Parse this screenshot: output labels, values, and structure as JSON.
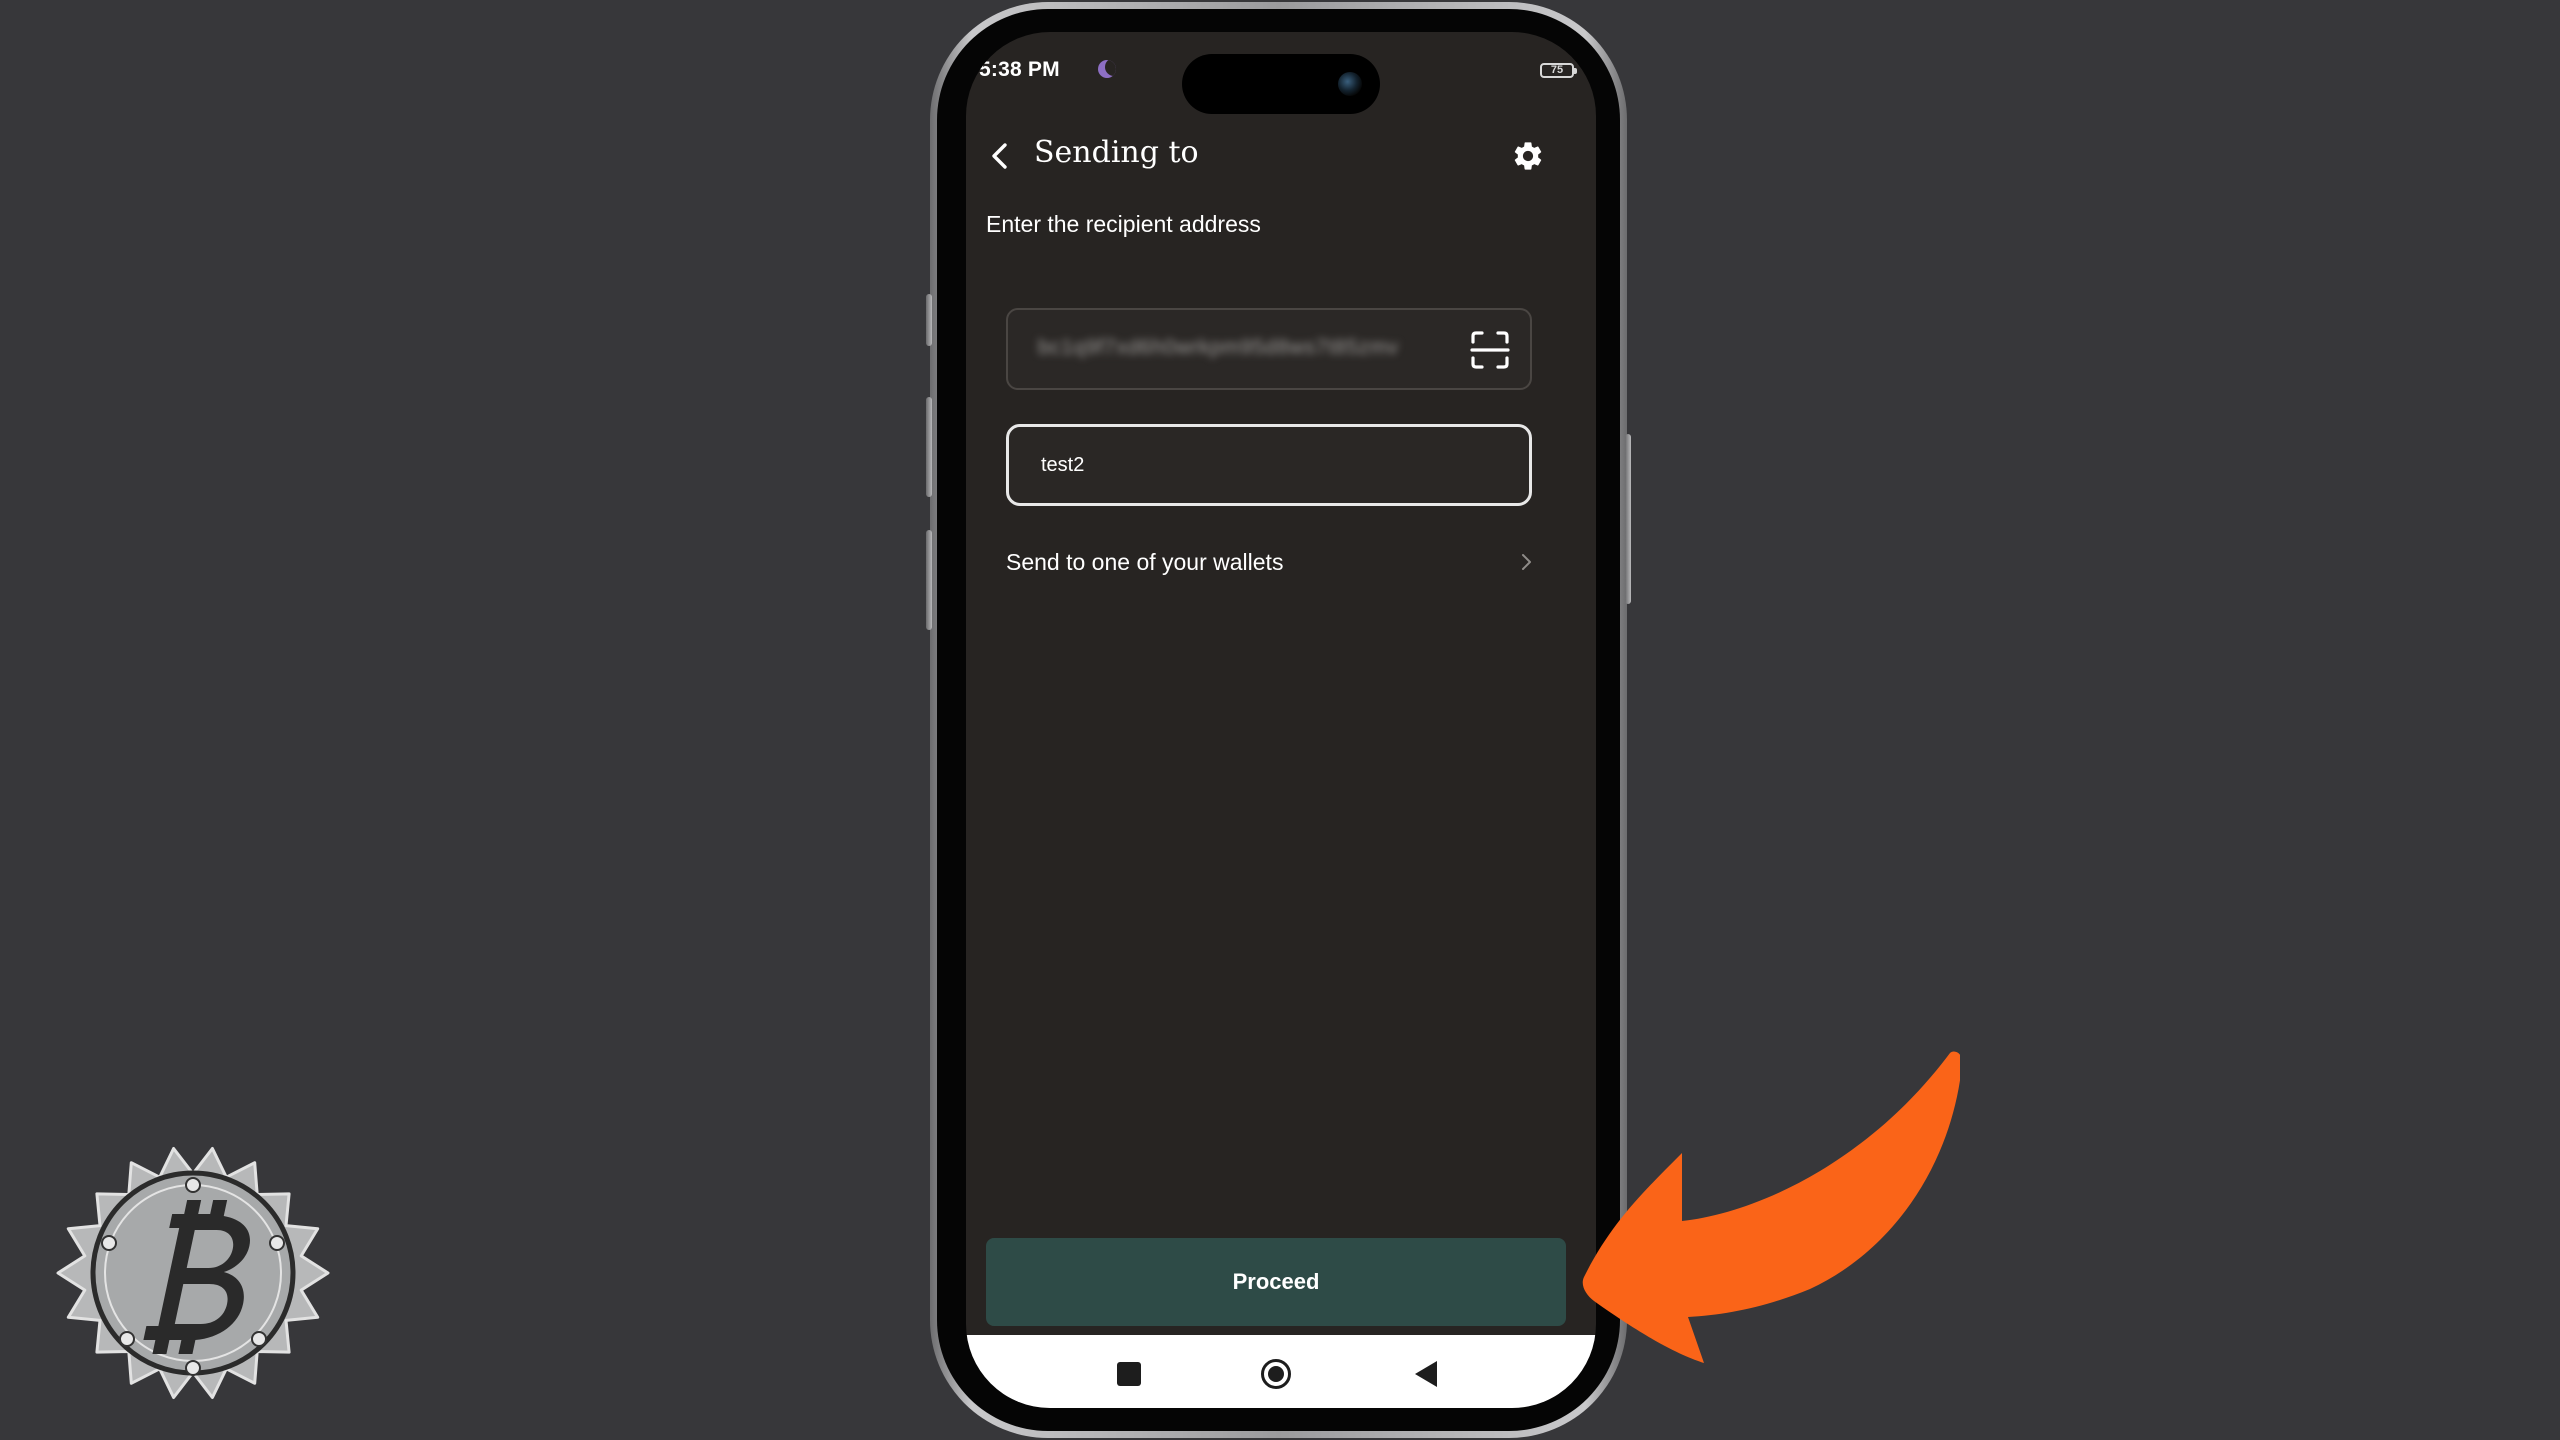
{
  "status_bar": {
    "time": "5:38 PM",
    "battery": "75"
  },
  "header": {
    "title": "Sending to",
    "back_icon": "chevron-left-icon",
    "settings_icon": "gear-icon"
  },
  "form": {
    "subtitle": "Enter the recipient address",
    "address_value": "bc1q9f7xd6h0wrkpm95d8ws7t85zmv",
    "scan_icon": "qr-scan-icon",
    "label_value": "test2",
    "wallets_link": "Send to one of your wallets"
  },
  "footer": {
    "proceed_label": "Proceed"
  },
  "nav_bar": {
    "recents_icon": "square-icon",
    "home_icon": "circle-icon",
    "back_icon": "triangle-back-icon"
  },
  "colors": {
    "background": "#37373a",
    "screen": "#272422",
    "proceed": "#2e4b47",
    "annotation": "#fa6418"
  }
}
